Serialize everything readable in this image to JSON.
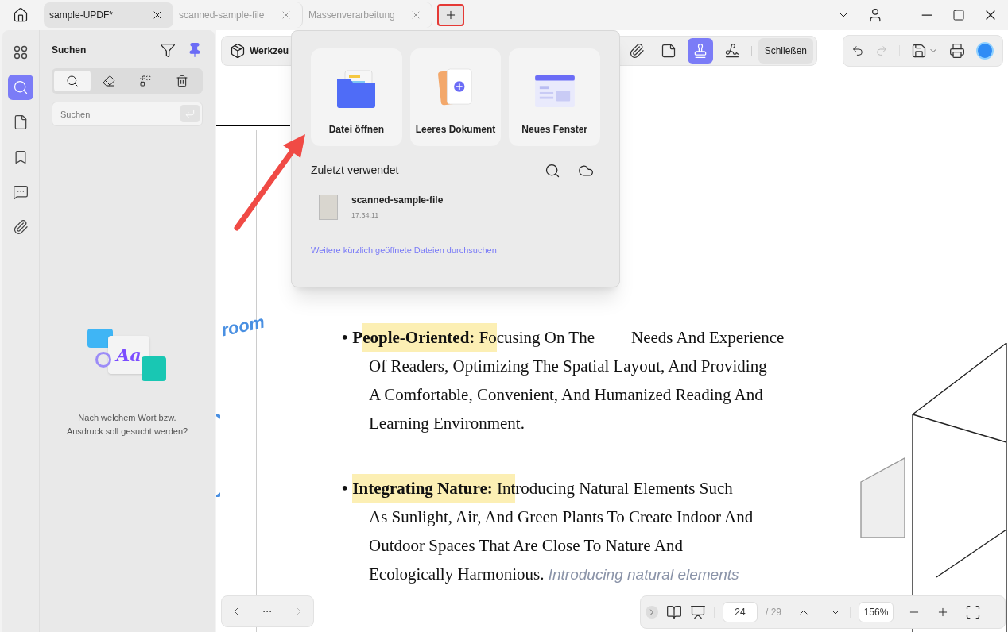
{
  "tabs": [
    {
      "label": "sample-UPDF*",
      "selected": true
    },
    {
      "label": "scanned-sample-file",
      "selected": false
    },
    {
      "label": "Massenverarbeitung",
      "selected": false
    }
  ],
  "rail": [
    {
      "kind": "apps",
      "selected": false
    },
    {
      "kind": "search",
      "selected": true
    },
    {
      "kind": "pages",
      "selected": false
    },
    {
      "kind": "bookmark",
      "selected": false
    },
    {
      "kind": "comment",
      "selected": false
    },
    {
      "kind": "attachment",
      "selected": false
    }
  ],
  "search_panel": {
    "title": "Suchen",
    "modes": [
      {
        "kind": "search",
        "selected": true
      },
      {
        "kind": "eraser",
        "selected": false
      },
      {
        "kind": "replace",
        "selected": false
      },
      {
        "kind": "trash",
        "selected": false
      }
    ],
    "field": {
      "placeholder": "Suchen"
    },
    "illustration_text": "Aa",
    "hint": "Nach welchem Wort bzw. Ausdruck soll gesucht werden?"
  },
  "doc_toolbar": {
    "tools_label": "Werkzeu",
    "tools": [
      {
        "kind": "attachment",
        "selected": false
      },
      {
        "kind": "note",
        "selected": false
      },
      {
        "kind": "stamp",
        "selected": true
      },
      {
        "kind": "signature",
        "selected": false
      }
    ],
    "close_label": "Schließen"
  },
  "right_toolbar": {
    "redo_disabled": true
  },
  "popup": {
    "cards": [
      {
        "kind": "folder",
        "label": "Datei öffnen"
      },
      {
        "kind": "blank",
        "label": "Leeres Dokument"
      },
      {
        "kind": "window",
        "label": "Neues Fenster"
      }
    ],
    "recent_title": "Zuletzt verwendet",
    "recent": [
      {
        "name": "scanned-sample-file",
        "time": "17:34:11"
      }
    ],
    "more_link": "Weitere kürzlich geöffnete Dateien durchsuchen"
  },
  "document": {
    "handwriting": "room",
    "bullets": [
      {
        "marker": "•",
        "lines": [
          [
            {
              "text": "P",
              "kind": "bold",
              "highlight": false
            },
            {
              "text": "eople-Oriented:",
              "kind": "bold",
              "highlight": true
            },
            {
              "text": " Fo",
              "kind": "plain",
              "highlight": true
            },
            {
              "text": "cusing On The",
              "kind": "plain",
              "highlight": false
            },
            {
              "text": "Needs And Experience",
              "kind": "spaced",
              "highlight": false
            }
          ],
          [
            {
              "text": "Of Readers, Optimizing The Spatial Layout, And Providing",
              "kind": "plain",
              "highlight": false
            }
          ],
          [
            {
              "text": "A Comfortable, Convenient, And Humanized Reading And",
              "kind": "plain",
              "highlight": false
            }
          ],
          [
            {
              "text": "Learning Environment.",
              "kind": "plain",
              "highlight": false
            }
          ]
        ]
      },
      {
        "marker": "•",
        "lines": [
          [
            {
              "text": "Integrating Nature:",
              "kind": "bold",
              "highlight": true
            },
            {
              "text": " Int",
              "kind": "plain",
              "highlight": true
            },
            {
              "text": "roducing Natural Elements Such",
              "kind": "plain",
              "highlight": false
            }
          ],
          [
            {
              "text": "As Sunlight, Air, And Green Plants To Create Indoor And",
              "kind": "plain",
              "highlight": false
            }
          ],
          [
            {
              "text": "Outdoor Spaces That Are Close To Nature And",
              "kind": "plain",
              "highlight": false
            }
          ],
          [
            {
              "text": "Ecologically Harmonious.",
              "kind": "plain",
              "highlight": false
            },
            {
              "text": " Introducing natural elements",
              "kind": "note",
              "highlight": false
            }
          ]
        ]
      }
    ]
  },
  "page_nav": {
    "more": "···"
  },
  "page_bar": {
    "page": "24",
    "total": "/ 29",
    "zoom": "156%"
  }
}
